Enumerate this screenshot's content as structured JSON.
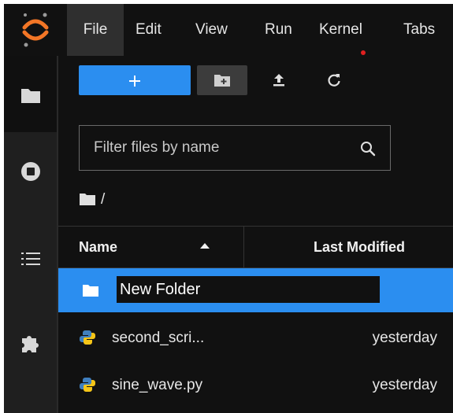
{
  "menubar": {
    "items": [
      "File",
      "Edit",
      "View",
      "Run",
      "Kernel",
      "Tabs"
    ]
  },
  "sidebar": {
    "items": [
      "folder-icon",
      "stop-circle-icon",
      "list-icon",
      "puzzle-icon"
    ]
  },
  "toolbar": {
    "new_launcher_icon": "plus-icon",
    "new_folder_icon": "new-folder-icon",
    "upload_icon": "upload-icon",
    "refresh_icon": "refresh-icon"
  },
  "filter": {
    "placeholder": "Filter files by name"
  },
  "breadcrumb": {
    "path": "/"
  },
  "file_list": {
    "headers": {
      "name": "Name",
      "modified": "Last Modified"
    },
    "rename_value": "New Folder",
    "rows": [
      {
        "name": "second_scri...",
        "modified": "yesterday"
      },
      {
        "name": "sine_wave.py",
        "modified": "yesterday"
      }
    ]
  },
  "colors": {
    "accent": "#2b8ef0",
    "background": "#111111",
    "kernel_indicator": "#e02020"
  }
}
